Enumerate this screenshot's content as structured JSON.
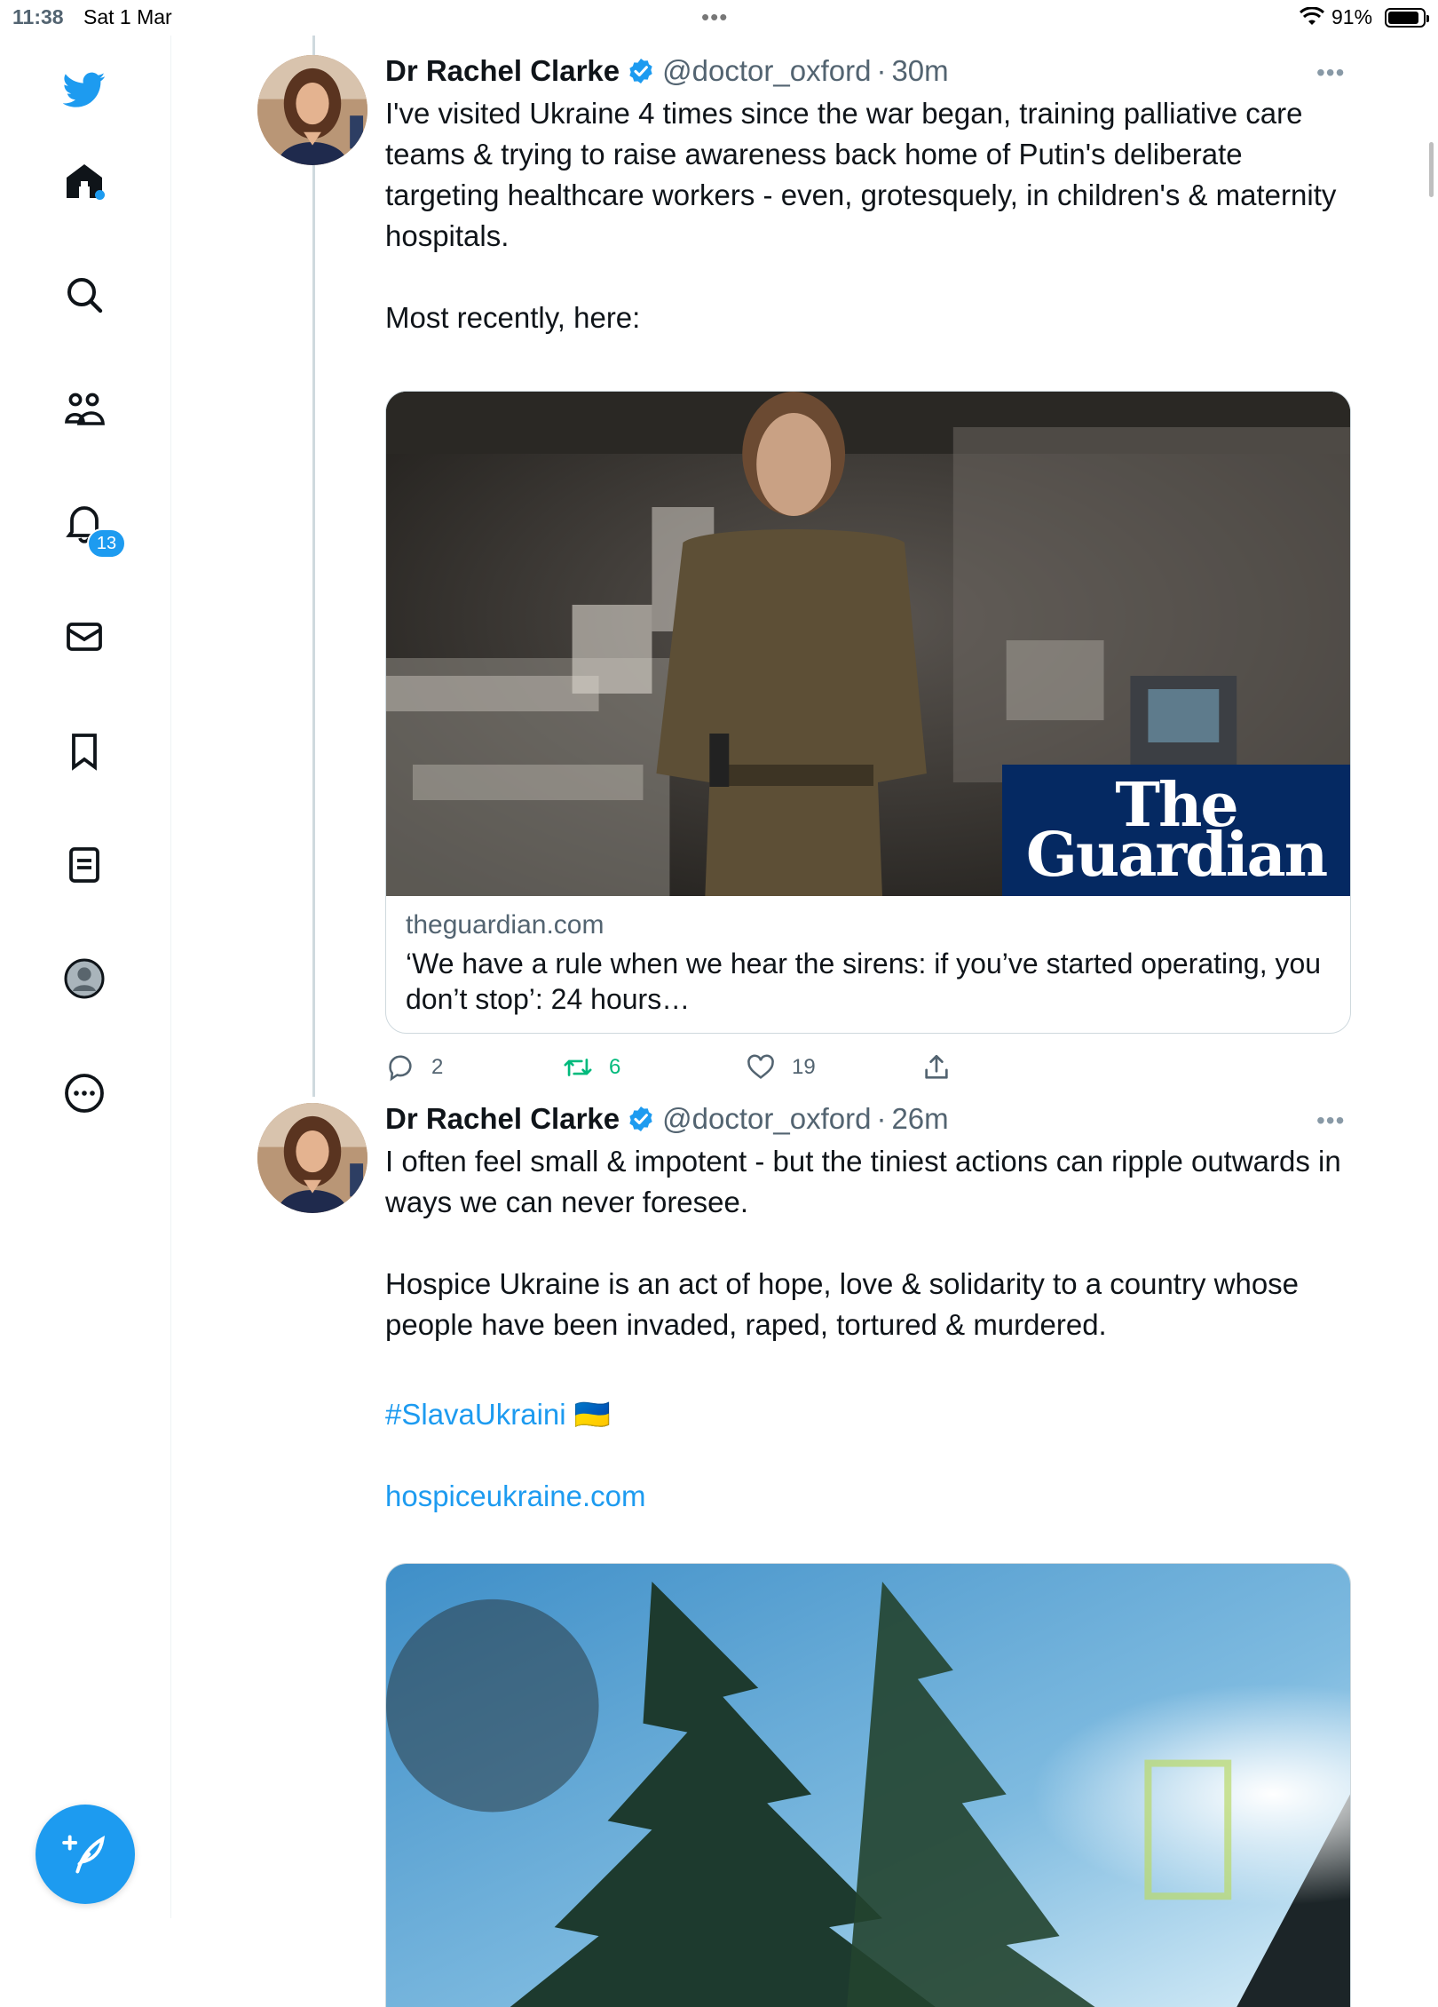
{
  "status_bar": {
    "time": "11:38",
    "date": "Sat 1 Mar",
    "battery": "91%",
    "battery_level": 0.91
  },
  "sidebar": {
    "items": [
      {
        "icon": "twitter-logo-icon"
      },
      {
        "icon": "home-icon"
      },
      {
        "icon": "search-icon"
      },
      {
        "icon": "communities-icon"
      },
      {
        "icon": "notifications-icon"
      },
      {
        "icon": "messages-icon"
      },
      {
        "icon": "bookmarks-icon"
      },
      {
        "icon": "lists-icon"
      },
      {
        "icon": "profile-icon"
      },
      {
        "icon": "more-icon"
      }
    ],
    "notification_count": "13",
    "compose_icon": "compose-icon"
  },
  "colors": {
    "accent": "#1d9bf0",
    "retweet": "#00ba7c",
    "guardian": "#052962"
  },
  "tweets": [
    {
      "name": "Dr Rachel Clarke",
      "handle": "@doctor_oxford",
      "sep": "·",
      "time": "30m",
      "more": "•••",
      "text": "I've visited Ukraine 4 times since the war began, training palliative care teams & trying to raise awareness back home of Putin's deliberate targeting healthcare workers - even, grotesquely, in children's & maternity hospitals.\n\nMost recently, here:",
      "card": {
        "logo_line1": "The",
        "logo_line2": "Guardian",
        "domain": "theguardian.com",
        "title": "‘We have a rule when we hear the sirens: if you’ve started operating, you don’t stop’: 24 hours…"
      },
      "actions": {
        "replies": "2",
        "retweets": "6",
        "likes": "19"
      }
    },
    {
      "name": "Dr Rachel Clarke",
      "handle": "@doctor_oxford",
      "sep": "·",
      "time": "26m",
      "more": "•••",
      "text": "I often feel small & impotent - but the tiniest actions can ripple outwards in ways we can never foresee.\n\nHospice Ukraine is an act of hope, love & solidarity to a country whose people have been invaded, raped, tortured & murdered.",
      "hashtag": "#SlavaUkraini",
      "flag": "🇺🇦",
      "link": "hospiceukraine.com"
    }
  ]
}
